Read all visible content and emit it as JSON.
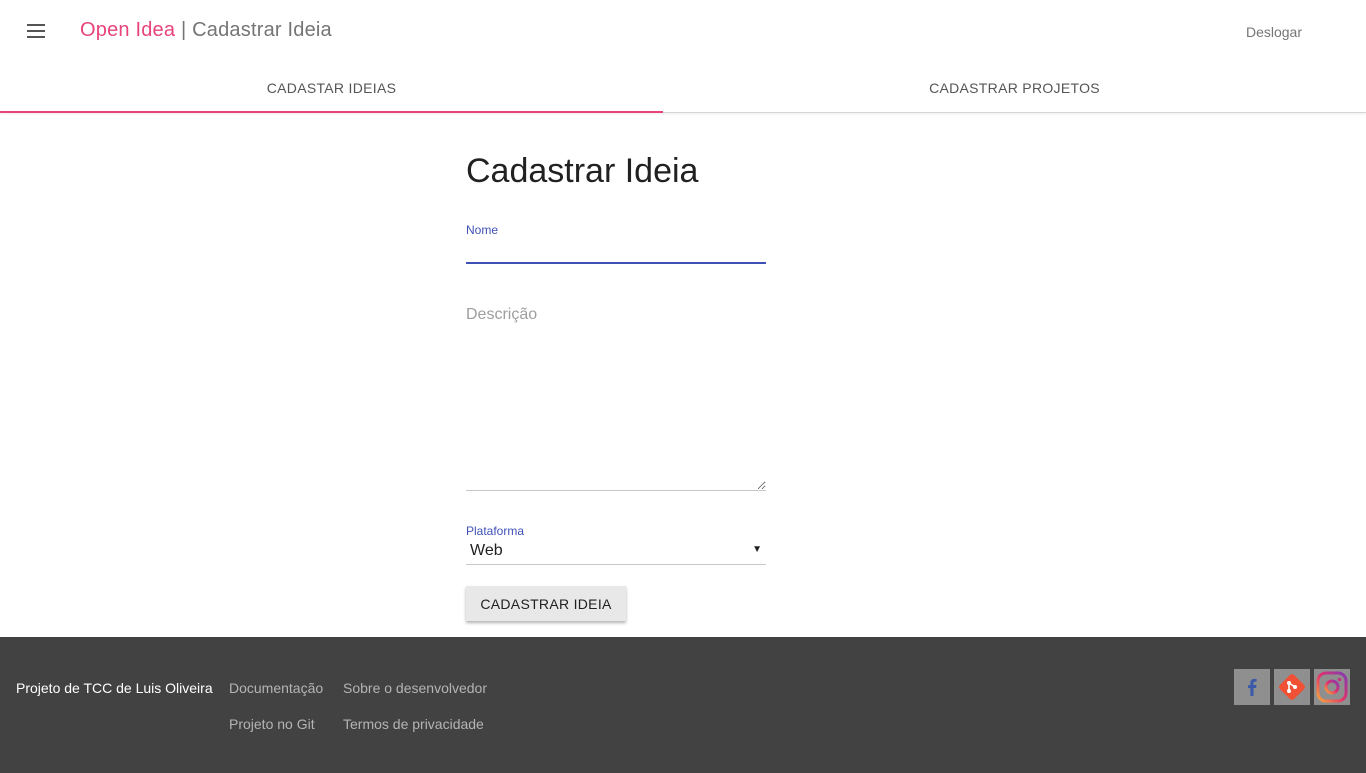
{
  "header": {
    "brand": "Open Idea",
    "separator": " | ",
    "page_title": "Cadastrar Ideia",
    "logout_label": "Deslogar"
  },
  "tabs": [
    {
      "label": "CADASTAR IDEIAS",
      "active": true
    },
    {
      "label": "CADASTRAR PROJETOS",
      "active": false
    }
  ],
  "form": {
    "title": "Cadastrar Ideia",
    "name_label": "Nome",
    "name_value": "",
    "description_placeholder": "Descrição",
    "platform_label": "Plataforma",
    "platform_value": "Web",
    "submit_label": "CADASTRAR IDEIA"
  },
  "footer": {
    "credit": "Projeto de TCC de Luis Oliveira",
    "links": [
      "Documentação",
      "Sobre o desenvolvedor",
      "Projeto no Git",
      "Termos de privacidade"
    ],
    "social": [
      "facebook-icon",
      "git-icon",
      "instagram-icon"
    ]
  },
  "colors": {
    "accent": "#e8447a",
    "primary": "#3f51b5",
    "footer_bg": "#424242"
  }
}
